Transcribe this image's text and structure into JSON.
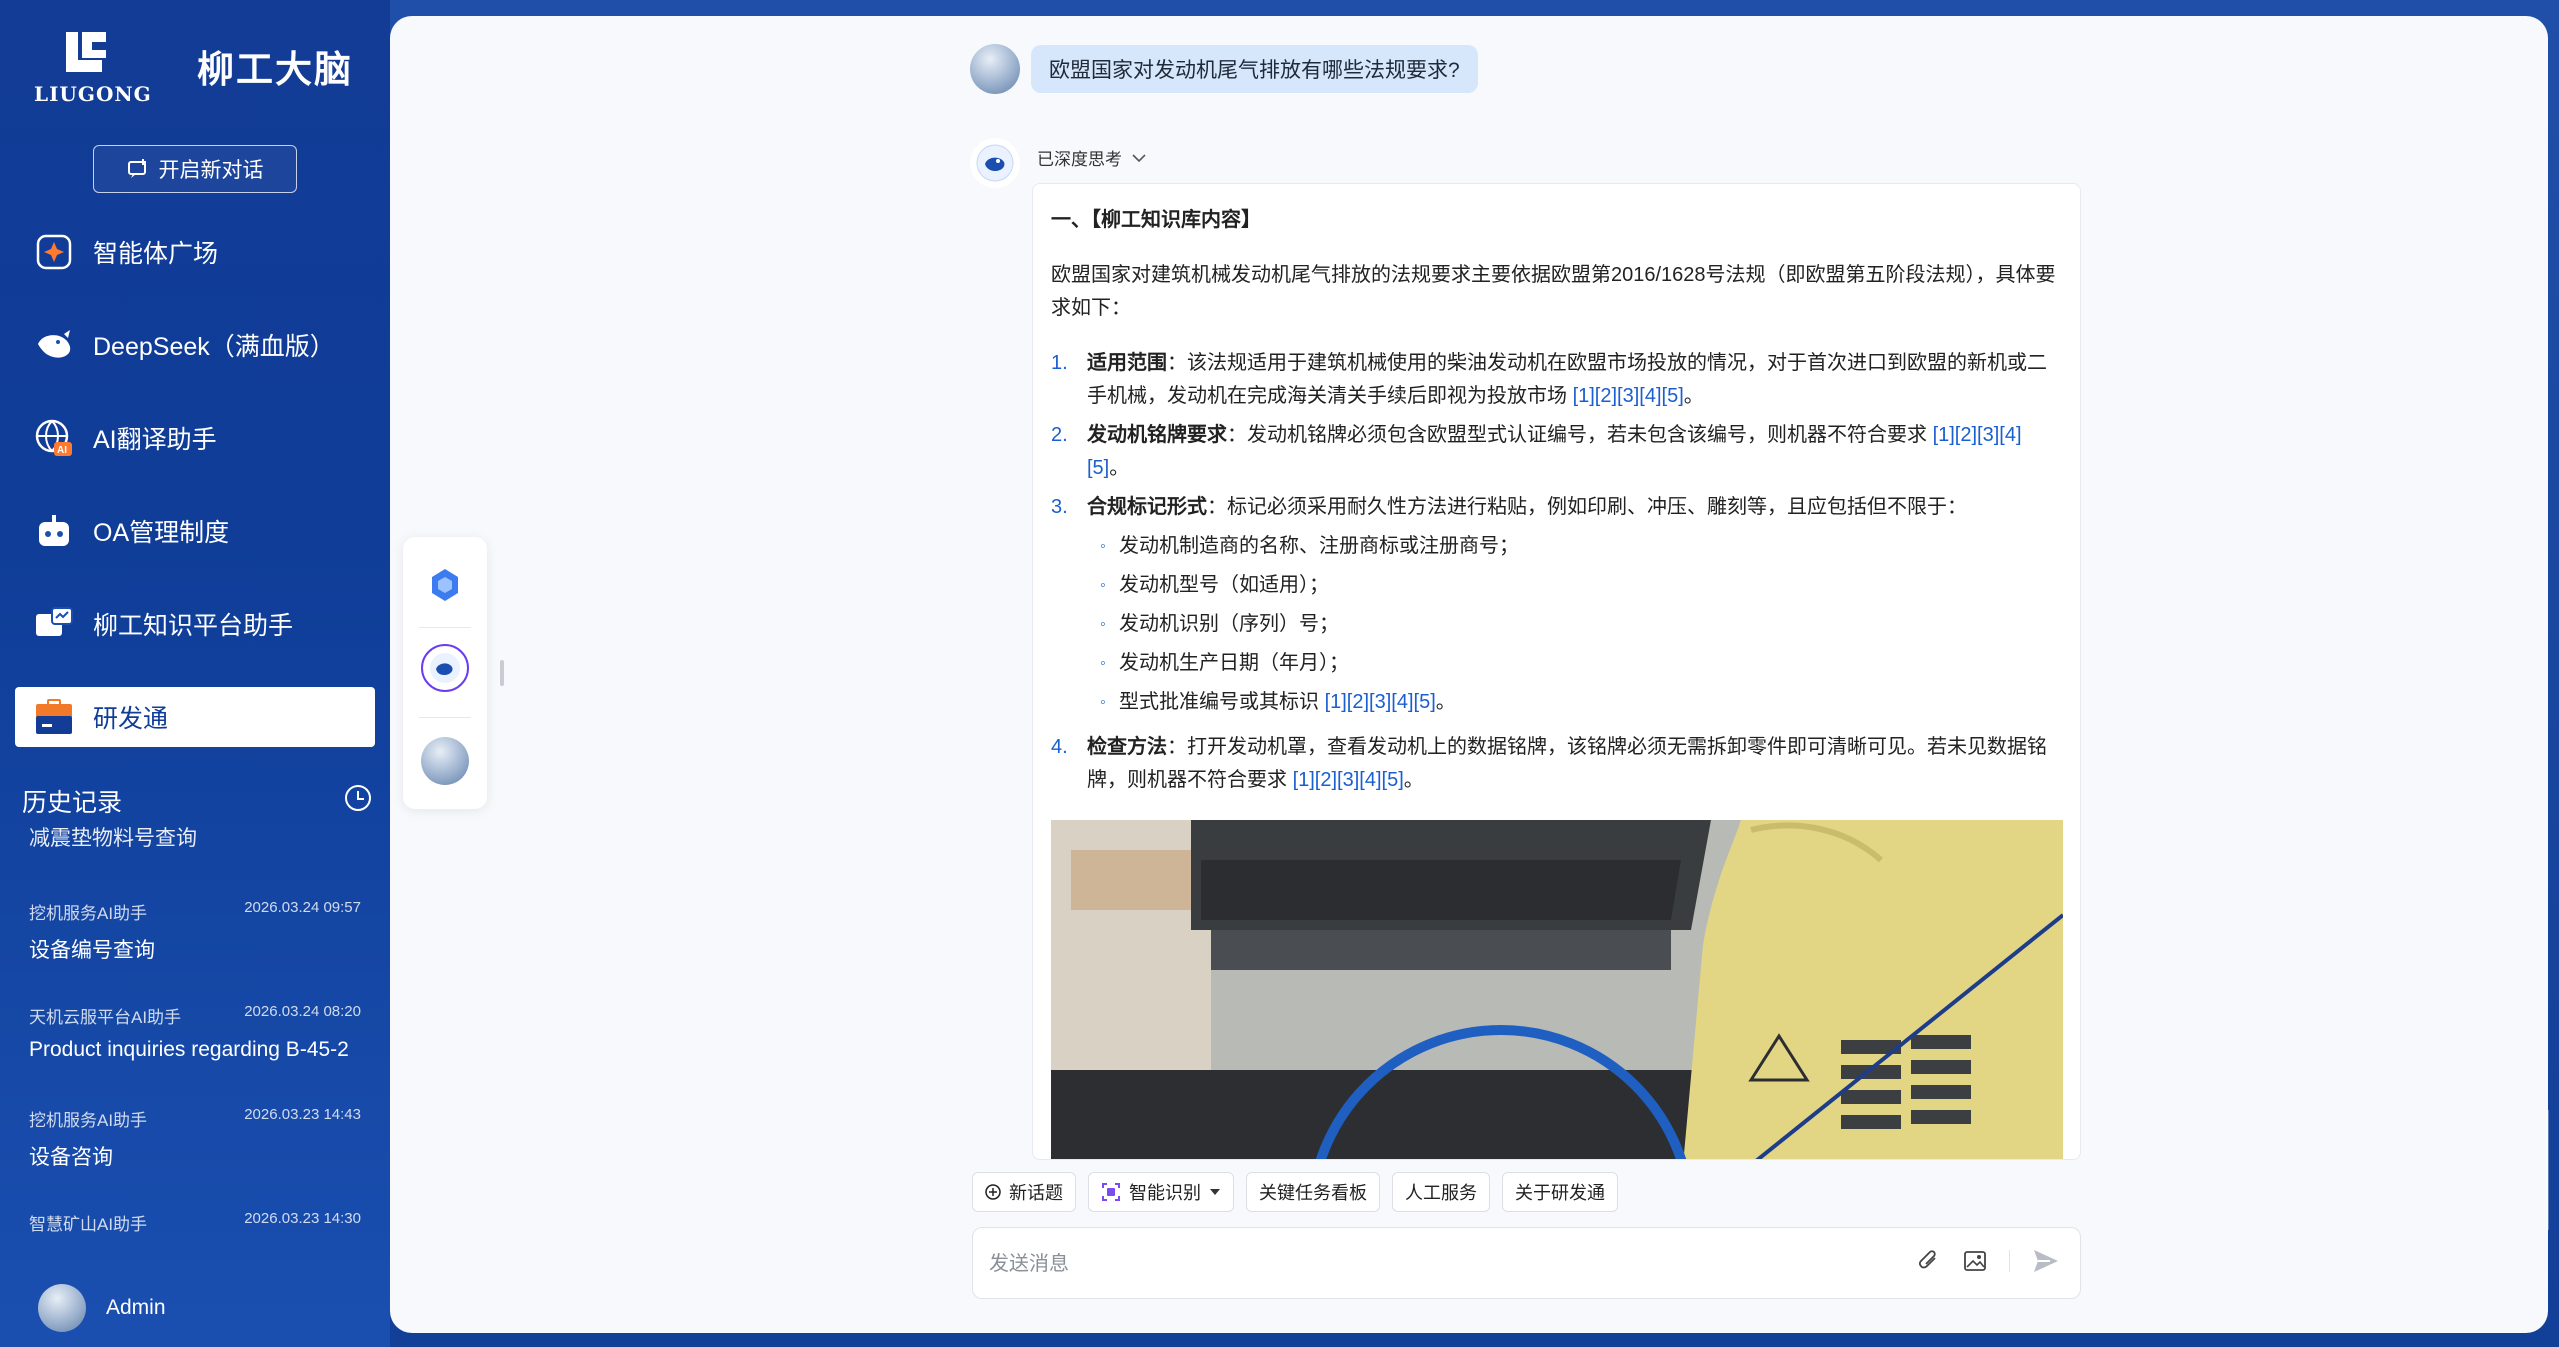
{
  "brand": {
    "logo_sub": "LIUGONG",
    "title": "柳工大脑"
  },
  "new_chat_label": "开启新对话",
  "nav": [
    {
      "label": "智能体广场",
      "icon": "sparkle-icon"
    },
    {
      "label": "DeepSeek（满血版）",
      "icon": "deepseek-whale-icon"
    },
    {
      "label": "AI翻译助手",
      "icon": "globe-ai-icon"
    },
    {
      "label": "OA管理制度",
      "icon": "robot-icon"
    },
    {
      "label": "柳工知识平台助手",
      "icon": "chat-board-icon"
    },
    {
      "label": "研发通",
      "icon": "briefcase-icon",
      "active": true
    }
  ],
  "history": {
    "title": "历史记录",
    "cut_item": "减震垫物料号查询",
    "items": [
      {
        "agent": "挖机服务AI助手",
        "date": "2026.03.24 09:57",
        "title": "设备编号查询"
      },
      {
        "agent": "天机云服平台AI助手",
        "date": "2026.03.24 08:20",
        "title": "Product inquiries regarding B-45-2"
      },
      {
        "agent": "挖机服务AI助手",
        "date": "2026.03.23 14:43",
        "title": "设备咨询"
      },
      {
        "agent": "智慧矿山AI助手",
        "date": "2026.03.23 14:30",
        "title": ""
      }
    ]
  },
  "user": {
    "name": "Admin"
  },
  "chat": {
    "question": "欧盟国家对发动机尾气排放有哪些法规要求?",
    "think_label": "已深度思考",
    "section_title": "一、【柳工知识库内容】",
    "intro": "欧盟国家对建筑机械发动机尾气排放的法规要求主要依据欧盟第2016/1628号法规（即欧盟第五阶段法规），具体要求如下：",
    "items": [
      {
        "num": "1.",
        "bold": "适用范围",
        "text": "：该法规适用于建筑机械使用的柴油发动机在欧盟市场投放的情况，对于首次进口到欧盟的新机或二手机械，发动机在完成海关清关手续后即视为投放市场 ",
        "cite": "[1][2][3][4][5]",
        "end": "。"
      },
      {
        "num": "2.",
        "bold": "发动机铭牌要求",
        "text": "：发动机铭牌必须包含欧盟型式认证编号，若未包含该编号，则机器不符合要求 ",
        "cite": "[1][2][3][4][5]",
        "end": "。"
      },
      {
        "num": "3.",
        "bold": "合规标记形式",
        "text": "：标记必须采用耐久性方法进行粘贴，例如印刷、冲压、雕刻等，且应包括但不限于：",
        "cite": "",
        "end": "",
        "subs": [
          {
            "text": "发动机制造商的名称、注册商标或注册商号；",
            "cite": ""
          },
          {
            "text": "发动机型号（如适用）；",
            "cite": ""
          },
          {
            "text": "发动机识别（序列）号；",
            "cite": ""
          },
          {
            "text": "发动机生产日期（年月）；",
            "cite": ""
          },
          {
            "text": "型式批准编号或其标识 ",
            "cite": "[1][2][3][4][5]",
            "end": "。"
          }
        ]
      },
      {
        "num": "4.",
        "bold": "检查方法",
        "text": "：打开发动机罩，查看发动机上的数据铭牌，该铭牌必须无需拆卸零件即可清晰可见。若未见数据铭牌，则机器不符合要求 ",
        "cite": "[1][2][3][4][5]",
        "end": "。"
      }
    ]
  },
  "chips": [
    {
      "label": "新话题",
      "icon": "plus-circle-icon"
    },
    {
      "label": "智能识别",
      "icon": "scan-icon",
      "dropdown": true
    },
    {
      "label": "关键任务看板",
      "icon": ""
    },
    {
      "label": "人工服务",
      "icon": ""
    },
    {
      "label": "关于研发通",
      "icon": ""
    }
  ],
  "input": {
    "placeholder": "发送消息"
  }
}
